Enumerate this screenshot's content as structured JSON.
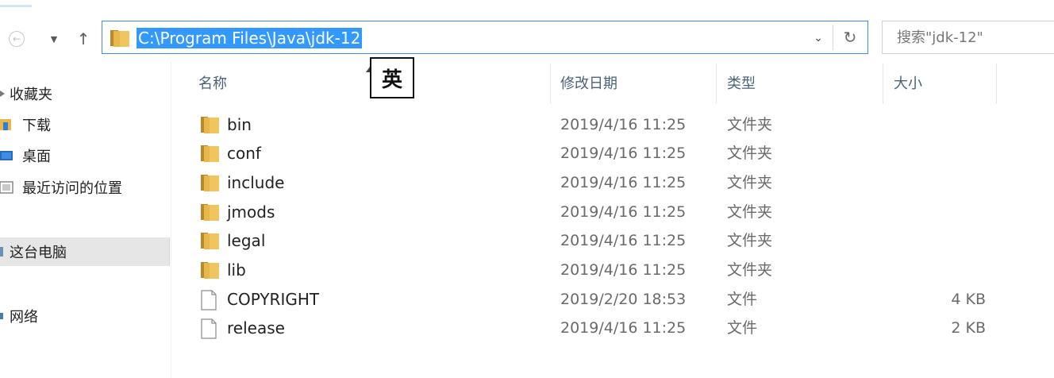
{
  "address_bar": {
    "path": "C:\\Program Files\\Java\\jdk-12"
  },
  "search": {
    "placeholder": "搜索\"jdk-12\""
  },
  "ime_indicator": "英",
  "sidebar": {
    "items": [
      {
        "label": "收藏夹",
        "icon": "star-icon"
      },
      {
        "label": "下载",
        "icon": "download-folder-icon"
      },
      {
        "label": "桌面",
        "icon": "desktop-icon"
      },
      {
        "label": "最近访问的位置",
        "icon": "recent-places-icon"
      },
      {
        "label": "这台电脑",
        "icon": "computer-icon",
        "selected": true
      },
      {
        "label": "网络",
        "icon": "network-icon"
      }
    ]
  },
  "columns": {
    "name": "名称",
    "date": "修改日期",
    "type": "类型",
    "size": "大小"
  },
  "files": [
    {
      "name": "bin",
      "date": "2019/4/16 11:25",
      "type": "文件夹",
      "size": "",
      "kind": "folder"
    },
    {
      "name": "conf",
      "date": "2019/4/16 11:25",
      "type": "文件夹",
      "size": "",
      "kind": "folder"
    },
    {
      "name": "include",
      "date": "2019/4/16 11:25",
      "type": "文件夹",
      "size": "",
      "kind": "folder"
    },
    {
      "name": "jmods",
      "date": "2019/4/16 11:25",
      "type": "文件夹",
      "size": "",
      "kind": "folder"
    },
    {
      "name": "legal",
      "date": "2019/4/16 11:25",
      "type": "文件夹",
      "size": "",
      "kind": "folder"
    },
    {
      "name": "lib",
      "date": "2019/4/16 11:25",
      "type": "文件夹",
      "size": "",
      "kind": "folder"
    },
    {
      "name": "COPYRIGHT",
      "date": "2019/2/20 18:53",
      "type": "文件",
      "size": "4 KB",
      "kind": "file"
    },
    {
      "name": "release",
      "date": "2019/4/16 11:25",
      "type": "文件",
      "size": "2 KB",
      "kind": "file"
    }
  ],
  "colors": {
    "selection": "#3399ff",
    "address_border": "#3d8ee0",
    "folder": "#e8b64a",
    "sidebar_selected": "#e6e6e6"
  }
}
